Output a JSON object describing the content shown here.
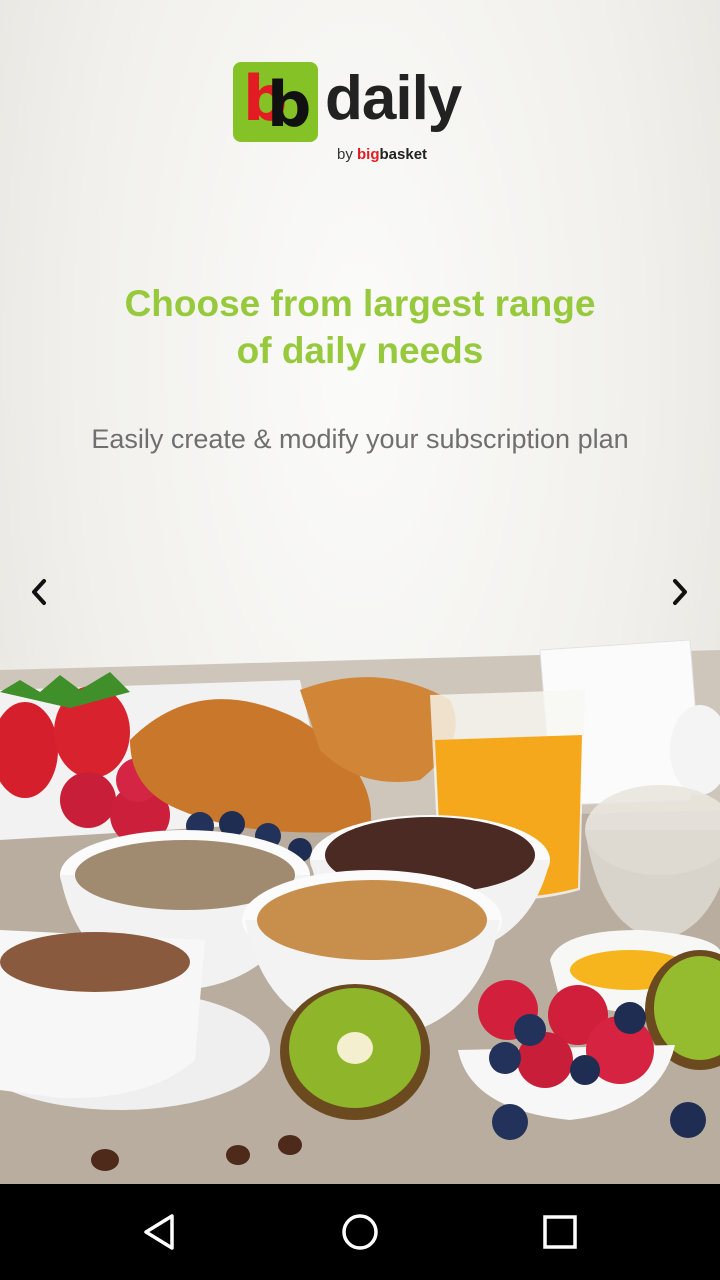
{
  "logo": {
    "mark_left": "b",
    "mark_right": "b",
    "word": "daily",
    "by_prefix": "by",
    "brand_big": "big",
    "brand_rest": "basket"
  },
  "slide": {
    "headline_line1": "Choose from largest range",
    "headline_line2": "of daily needs",
    "subtitle": "Easily create & modify your subscription plan"
  },
  "carousel": {
    "prev_icon": "chevron-left-icon",
    "next_icon": "chevron-right-icon"
  },
  "colors": {
    "brand_green": "#84c225",
    "headline_green": "#97c93d",
    "brand_red": "#e31b23",
    "subtitle_gray": "#6f6f6f"
  },
  "navbar": {
    "back_icon": "back-triangle-icon",
    "home_icon": "home-circle-icon",
    "recents_icon": "recents-square-icon"
  }
}
